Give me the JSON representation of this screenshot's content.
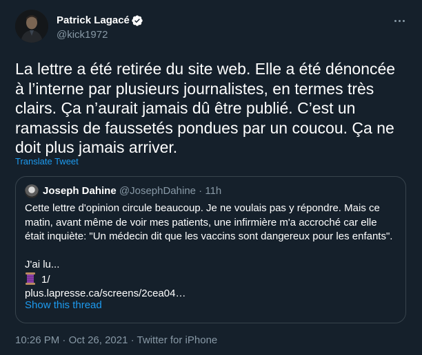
{
  "author": {
    "display_name": "Patrick Lagacé",
    "handle": "@kick1972",
    "verified": true
  },
  "tweet": {
    "text": "La lettre a été retirée du site web. Elle a été dénoncée à l’interne par plusieurs journalistes, en termes très clairs. Ça n’aurait jamais dû être publié. C’est un ramassis de faussetés pondues par un coucou. Ça ne doit plus jamais arriver.",
    "translate_label": "Translate Tweet"
  },
  "quote": {
    "display_name": "Joseph Dahine",
    "handle": "@JosephDahine",
    "separator": " · ",
    "time": "11h",
    "lines": [
      "Cette lettre d'opinion circule beaucoup. Je ne voulais pas y répondre. Mais ce",
      "matin, avant même de voir mes patients, une infirmière m'a accroché car elle",
      "était inquiète: \"Un médecin dit que les vaccins sont dangereux pour les enfants\"."
    ],
    "line_jai": "J'ai  lu...",
    "thread_marker": "1/",
    "thread_icon": "thread-spool-icon",
    "link": "plus.lapresse.ca/screens/2cea04…",
    "show_thread_label": "Show this thread"
  },
  "footer": {
    "time": "10:26 PM",
    "separator": " · ",
    "date": "Oct 26, 2021",
    "source": "Twitter for iPhone"
  },
  "colors": {
    "background": "#15202b",
    "text_primary": "#ffffff",
    "text_secondary": "#8899a6",
    "accent_blue": "#1d9bf0",
    "border": "#38444d",
    "spool_purple": "#8a3fa8"
  }
}
